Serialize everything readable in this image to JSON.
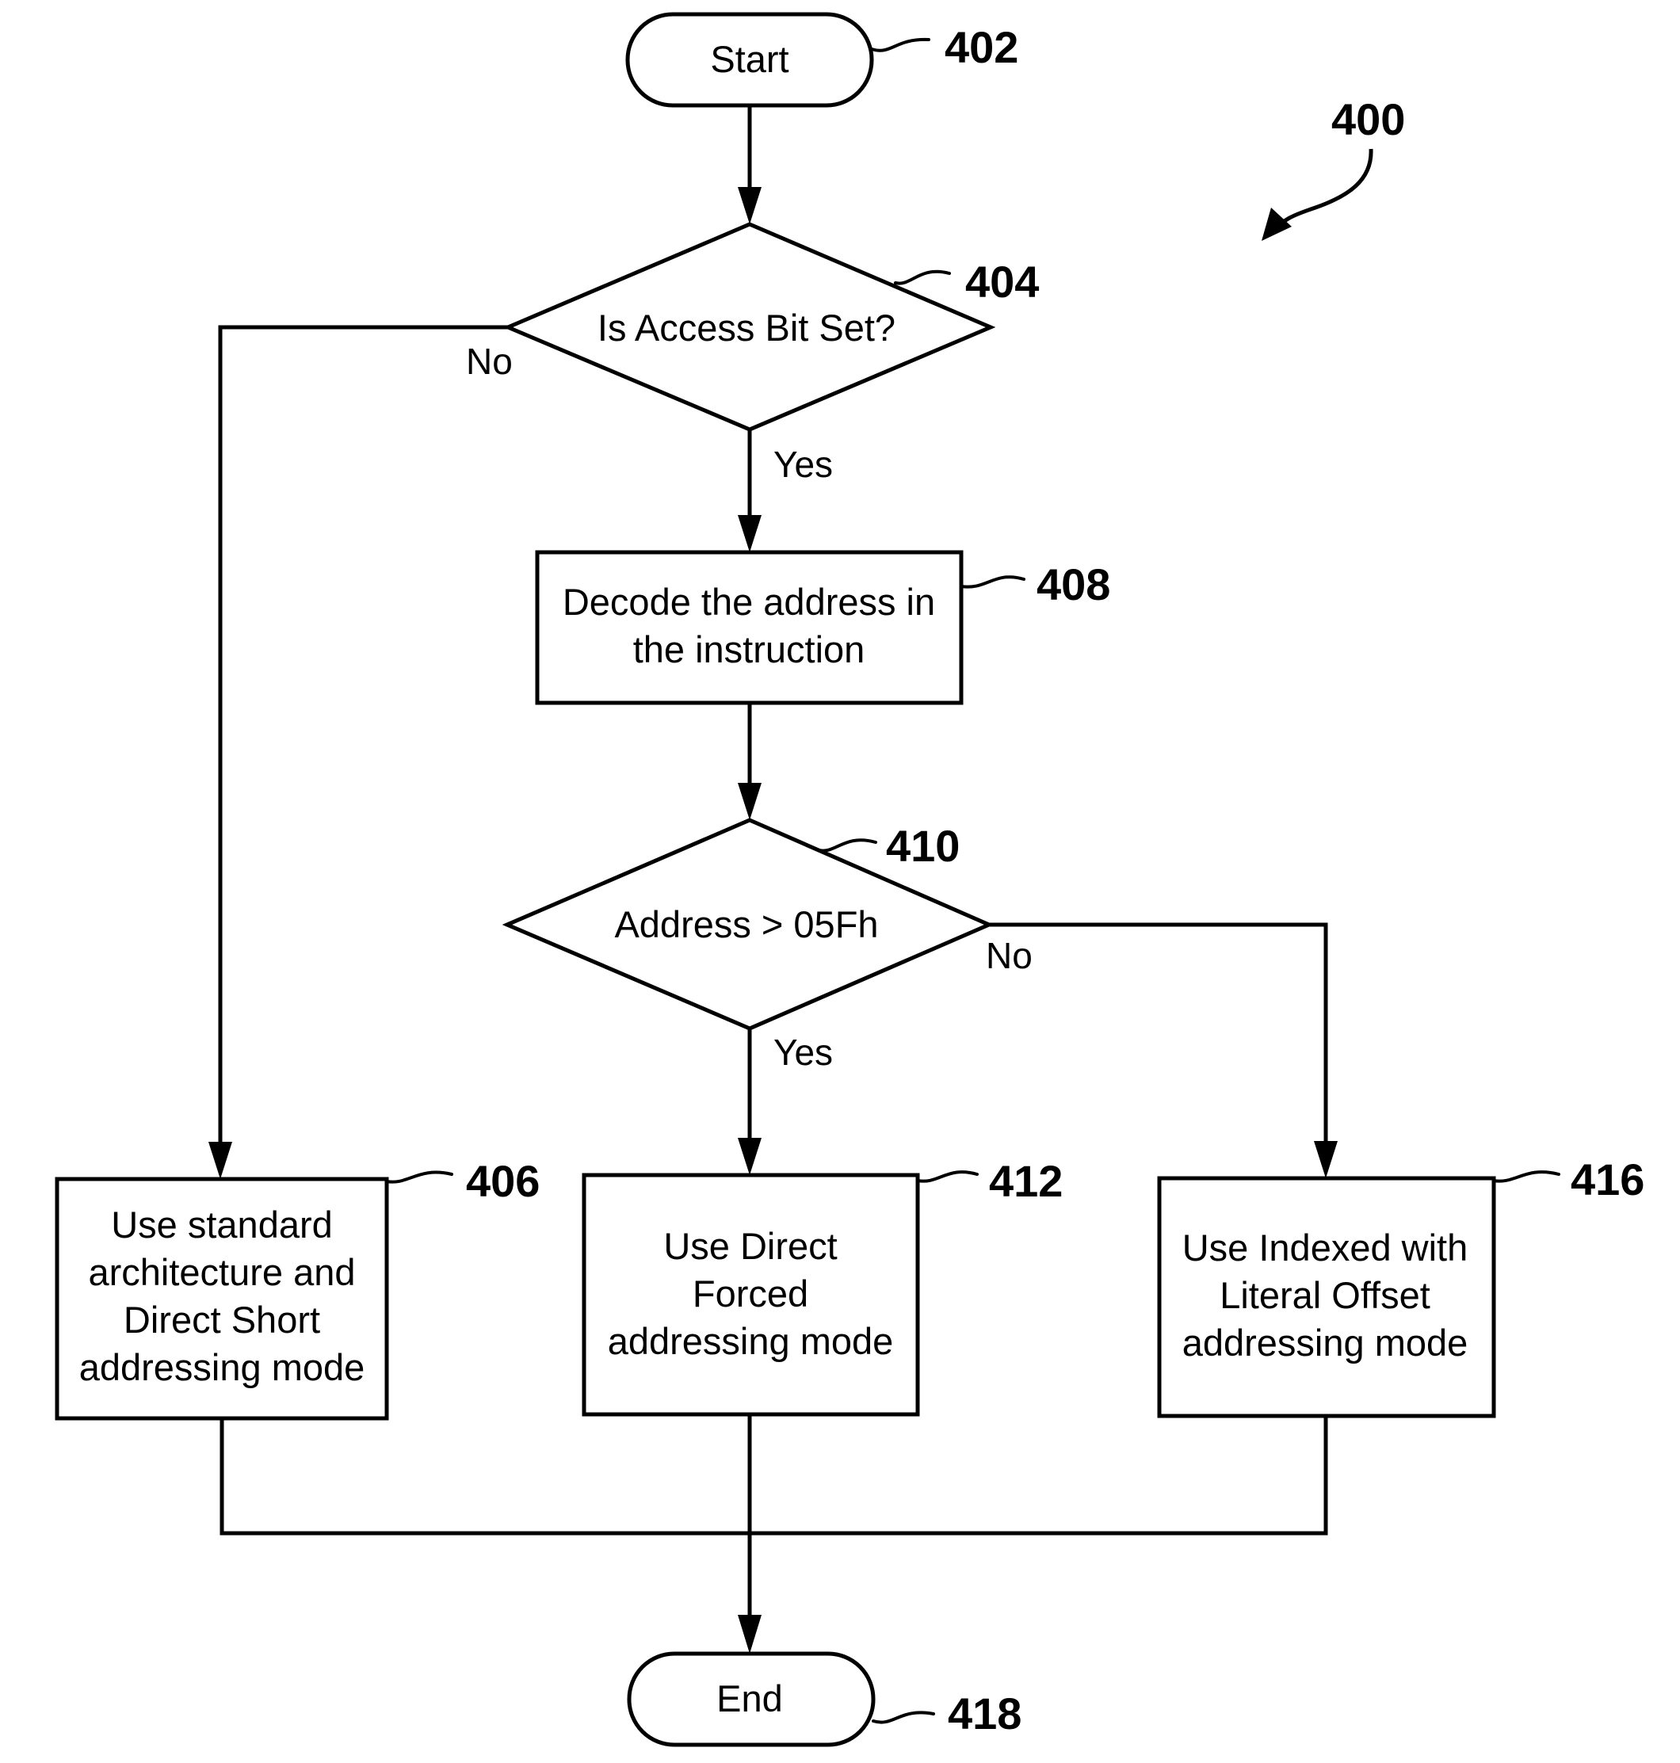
{
  "figure": {
    "reference": "400"
  },
  "nodes": {
    "start": {
      "text": "Start",
      "ref": "402",
      "shape": "terminal"
    },
    "access_bit": {
      "text": "Is Access Bit Set?",
      "ref": "404",
      "shape": "decision"
    },
    "decode": {
      "lines": [
        "Decode the address in",
        "the instruction"
      ],
      "ref": "408",
      "shape": "process"
    },
    "address_check": {
      "text": "Address > 05Fh",
      "ref": "410",
      "shape": "decision"
    },
    "standard_mode": {
      "lines": [
        "Use standard",
        "architecture and",
        "Direct Short",
        "addressing mode"
      ],
      "ref": "406",
      "shape": "process"
    },
    "direct_forced": {
      "lines": [
        "Use Direct",
        "Forced",
        "addressing mode"
      ],
      "ref": "412",
      "shape": "process"
    },
    "indexed_literal": {
      "lines": [
        "Use Indexed with",
        "Literal Offset",
        "addressing mode"
      ],
      "ref": "416",
      "shape": "process"
    },
    "end": {
      "text": "End",
      "ref": "418",
      "shape": "terminal"
    }
  },
  "branches": {
    "access_bit_no": "No",
    "access_bit_yes": "Yes",
    "address_check_no": "No",
    "address_check_yes": "Yes"
  },
  "edges": [
    {
      "from": "start",
      "to": "access_bit",
      "label": ""
    },
    {
      "from": "access_bit",
      "to": "standard_mode",
      "label": "No"
    },
    {
      "from": "access_bit",
      "to": "decode",
      "label": "Yes"
    },
    {
      "from": "decode",
      "to": "address_check",
      "label": ""
    },
    {
      "from": "address_check",
      "to": "direct_forced",
      "label": "Yes"
    },
    {
      "from": "address_check",
      "to": "indexed_literal",
      "label": "No"
    },
    {
      "from": "standard_mode",
      "to": "end",
      "label": ""
    },
    {
      "from": "direct_forced",
      "to": "end",
      "label": ""
    },
    {
      "from": "indexed_literal",
      "to": "end",
      "label": ""
    }
  ]
}
